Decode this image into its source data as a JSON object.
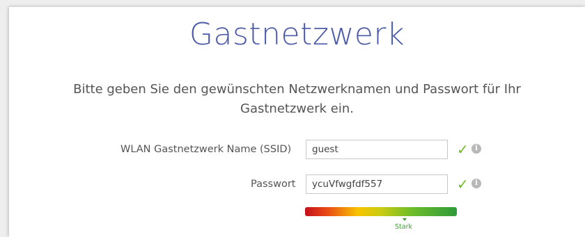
{
  "page": {
    "title": "Gastnetzwerk",
    "intro": "Bitte geben Sie den gewünschten Netzwerknamen und Passwort für Ihr Gastnetzwerk ein."
  },
  "form": {
    "ssid": {
      "label": "WLAN Gastnetzwerk Name (SSID)",
      "value": "guest",
      "valid_icon": "checkmark-icon",
      "info_icon": "info-icon"
    },
    "password": {
      "label": "Passwort",
      "value": "ycuVfwgfdf557",
      "valid_icon": "checkmark-icon",
      "info_icon": "info-icon"
    }
  },
  "strength": {
    "label": "Stark",
    "level": 0.75
  },
  "colors": {
    "title": "#4a5aa8",
    "check": "#6fb92c",
    "strength_label": "#3f9d33"
  }
}
